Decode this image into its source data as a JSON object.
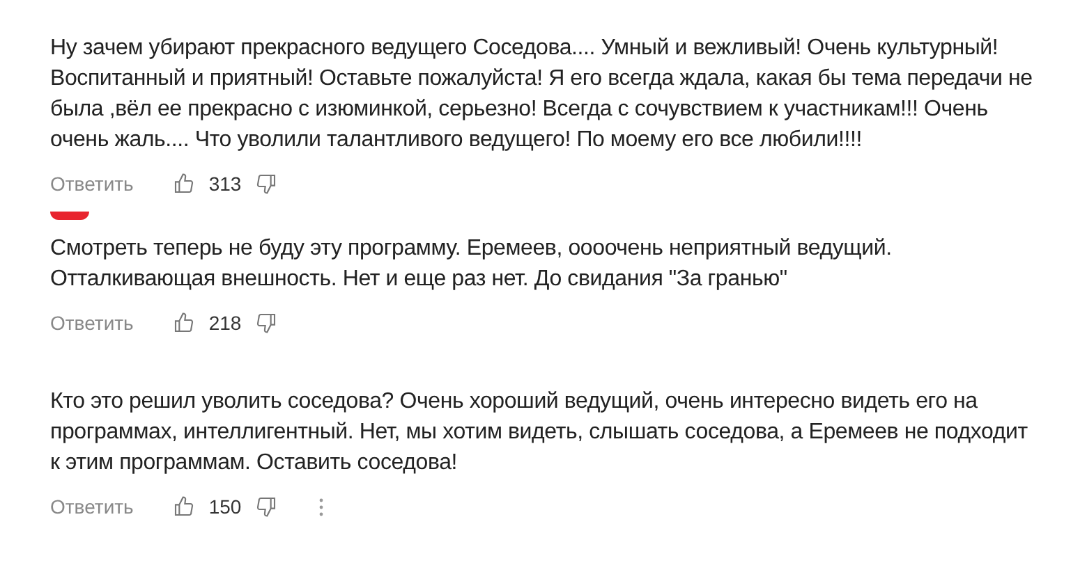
{
  "comments": [
    {
      "text": "Ну зачем убирают прекрасного ведущего Соседова.... Умный и вежливый! Очень культурный! Воспитанный и приятный! Оставьте пожалуйста! Я его всегда ждала, какая бы тема передачи не была ,вёл ее прекрасно с изюминкой, серьезно! Всегда с сочувствием к участникам!!! Очень очень жаль.... Что уволили талантливого ведущего! По моему его все любили!!!!",
      "reply": "Ответить",
      "likes": "313",
      "menu": false,
      "badge": false
    },
    {
      "text": "Смотреть теперь не буду эту программу. Еремеев, оооочень неприятный ведущий. Отталкивающая внешность. Нет и еще раз нет. До свидания \"За гранью\"",
      "reply": "Ответить",
      "likes": "218",
      "menu": false,
      "badge": true
    },
    {
      "text": "Кто это решил уволить соседова? Очень хороший ведущий, очень интересно видеть его на программах, интеллигентный. Нет, мы хотим видеть, слышать соседова, а Еремеев не подходит к этим программам. Оставить соседова!",
      "reply": "Ответить",
      "likes": "150",
      "menu": true,
      "badge": false
    }
  ]
}
